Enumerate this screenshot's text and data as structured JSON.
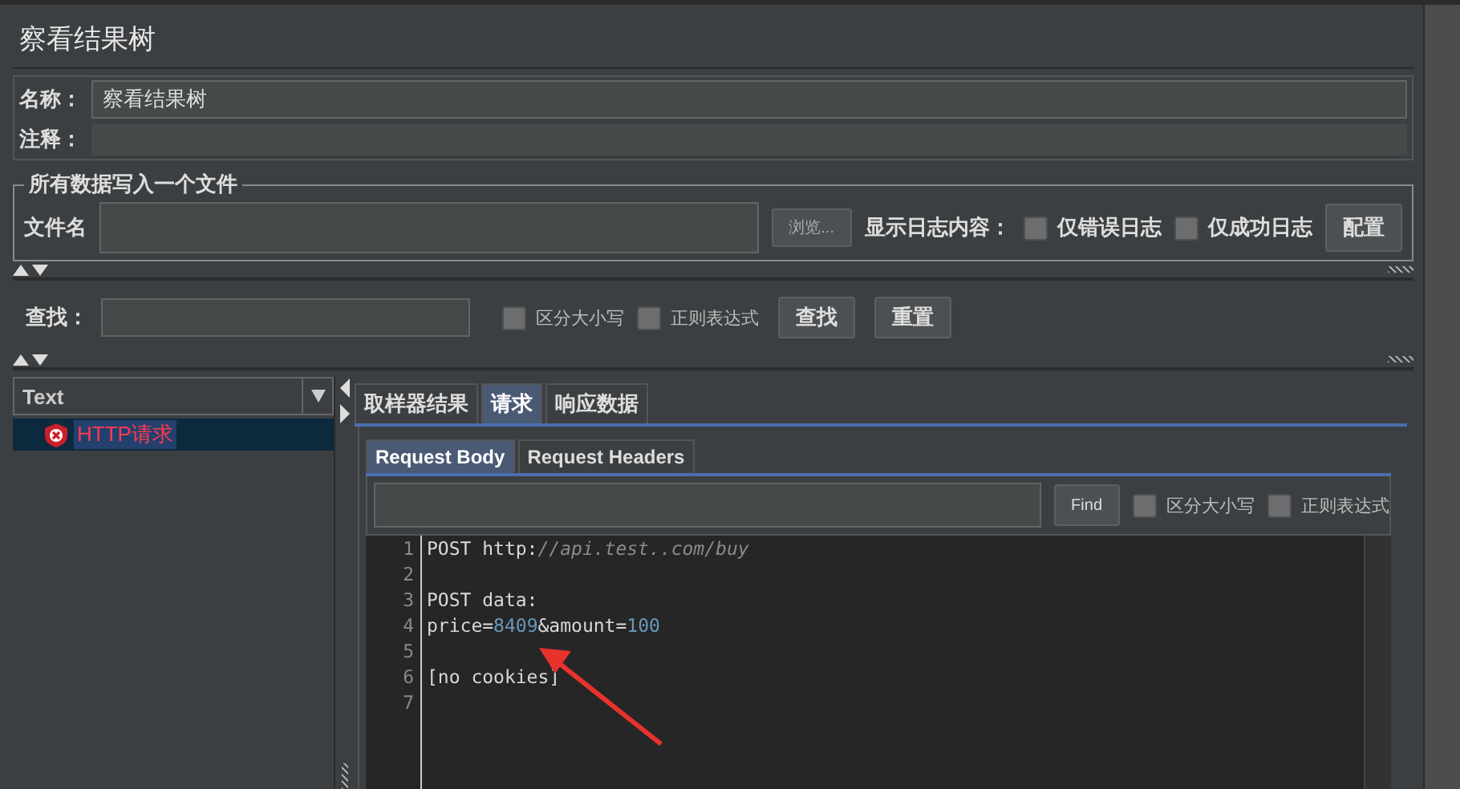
{
  "title": "察看结果树",
  "name_field": {
    "label": "名称：",
    "value": "察看结果树"
  },
  "comment_field": {
    "label": "注释："
  },
  "file_group": {
    "legend": "所有数据写入一个文件",
    "file_label": "文件名",
    "browse_button": "浏览...",
    "log_label": "显示日志内容：",
    "checkboxes": [
      {
        "label": "仅错误日志",
        "checked": false
      },
      {
        "label": "仅成功日志",
        "checked": false
      }
    ],
    "config_button": "配置"
  },
  "search": {
    "label": "查找：",
    "options": [
      {
        "label": "区分大小写",
        "checked": false
      },
      {
        "label": "正则表达式",
        "checked": false
      }
    ],
    "buttons": [
      "查找",
      "重置"
    ]
  },
  "renderer_select": {
    "value": "Text"
  },
  "tree": [
    {
      "label": "HTTP请求",
      "kind": "error",
      "selected": true
    }
  ],
  "result_tabs": [
    {
      "label": "取样器结果",
      "selected": false
    },
    {
      "label": "请求",
      "selected": true
    },
    {
      "label": "响应数据",
      "selected": false
    }
  ],
  "request_tabs": [
    {
      "label": "Request Body",
      "selected": true
    },
    {
      "label": "Request Headers",
      "selected": false
    }
  ],
  "find_bar": {
    "button": "Find",
    "options": [
      {
        "label": "区分大小写",
        "checked": false
      },
      {
        "label": "正则表达式",
        "checked": false
      }
    ]
  },
  "code_lines": [
    {
      "number": "1",
      "segments": [
        {
          "text": "POST http:",
          "kind": "plain"
        },
        {
          "text": "//api.test..com/buy",
          "kind": "comment"
        }
      ]
    },
    {
      "number": "2"
    },
    {
      "number": "3",
      "segments": [
        {
          "text": "POST data:",
          "kind": "plain"
        }
      ]
    },
    {
      "number": "4",
      "segments": [
        {
          "text": "price=",
          "kind": "plain"
        },
        {
          "text": "8409",
          "kind": "number"
        },
        {
          "text": "&amount=",
          "kind": "plain"
        },
        {
          "text": "100",
          "kind": "number"
        }
      ]
    },
    {
      "number": "5"
    },
    {
      "number": "6",
      "segments": [
        {
          "text": "[no cookies]",
          "kind": "plain"
        }
      ]
    },
    {
      "number": "7"
    }
  ]
}
